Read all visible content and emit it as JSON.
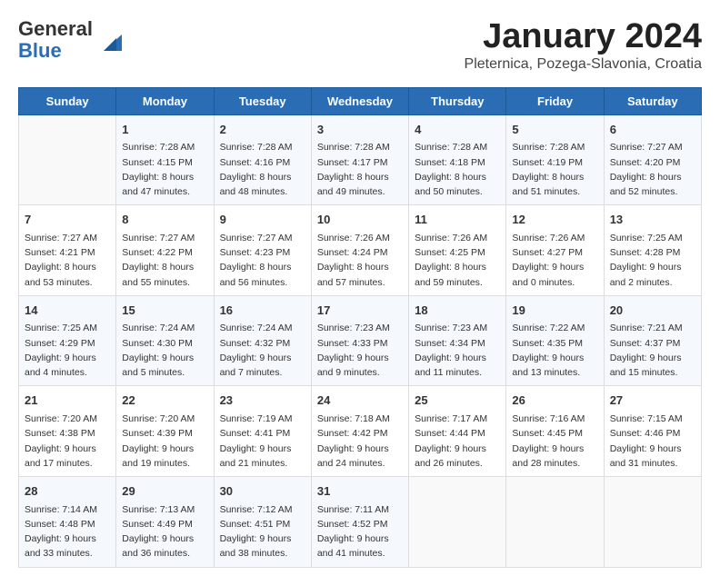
{
  "header": {
    "logo_general": "General",
    "logo_blue": "Blue",
    "month_title": "January 2024",
    "location": "Pleternica, Pozega-Slavonia, Croatia"
  },
  "weekdays": [
    "Sunday",
    "Monday",
    "Tuesday",
    "Wednesday",
    "Thursday",
    "Friday",
    "Saturday"
  ],
  "weeks": [
    [
      {
        "day": null,
        "info": null
      },
      {
        "day": "1",
        "info": "Sunrise: 7:28 AM\nSunset: 4:15 PM\nDaylight: 8 hours\nand 47 minutes."
      },
      {
        "day": "2",
        "info": "Sunrise: 7:28 AM\nSunset: 4:16 PM\nDaylight: 8 hours\nand 48 minutes."
      },
      {
        "day": "3",
        "info": "Sunrise: 7:28 AM\nSunset: 4:17 PM\nDaylight: 8 hours\nand 49 minutes."
      },
      {
        "day": "4",
        "info": "Sunrise: 7:28 AM\nSunset: 4:18 PM\nDaylight: 8 hours\nand 50 minutes."
      },
      {
        "day": "5",
        "info": "Sunrise: 7:28 AM\nSunset: 4:19 PM\nDaylight: 8 hours\nand 51 minutes."
      },
      {
        "day": "6",
        "info": "Sunrise: 7:27 AM\nSunset: 4:20 PM\nDaylight: 8 hours\nand 52 minutes."
      }
    ],
    [
      {
        "day": "7",
        "info": "Sunrise: 7:27 AM\nSunset: 4:21 PM\nDaylight: 8 hours\nand 53 minutes."
      },
      {
        "day": "8",
        "info": "Sunrise: 7:27 AM\nSunset: 4:22 PM\nDaylight: 8 hours\nand 55 minutes."
      },
      {
        "day": "9",
        "info": "Sunrise: 7:27 AM\nSunset: 4:23 PM\nDaylight: 8 hours\nand 56 minutes."
      },
      {
        "day": "10",
        "info": "Sunrise: 7:26 AM\nSunset: 4:24 PM\nDaylight: 8 hours\nand 57 minutes."
      },
      {
        "day": "11",
        "info": "Sunrise: 7:26 AM\nSunset: 4:25 PM\nDaylight: 8 hours\nand 59 minutes."
      },
      {
        "day": "12",
        "info": "Sunrise: 7:26 AM\nSunset: 4:27 PM\nDaylight: 9 hours\nand 0 minutes."
      },
      {
        "day": "13",
        "info": "Sunrise: 7:25 AM\nSunset: 4:28 PM\nDaylight: 9 hours\nand 2 minutes."
      }
    ],
    [
      {
        "day": "14",
        "info": "Sunrise: 7:25 AM\nSunset: 4:29 PM\nDaylight: 9 hours\nand 4 minutes."
      },
      {
        "day": "15",
        "info": "Sunrise: 7:24 AM\nSunset: 4:30 PM\nDaylight: 9 hours\nand 5 minutes."
      },
      {
        "day": "16",
        "info": "Sunrise: 7:24 AM\nSunset: 4:32 PM\nDaylight: 9 hours\nand 7 minutes."
      },
      {
        "day": "17",
        "info": "Sunrise: 7:23 AM\nSunset: 4:33 PM\nDaylight: 9 hours\nand 9 minutes."
      },
      {
        "day": "18",
        "info": "Sunrise: 7:23 AM\nSunset: 4:34 PM\nDaylight: 9 hours\nand 11 minutes."
      },
      {
        "day": "19",
        "info": "Sunrise: 7:22 AM\nSunset: 4:35 PM\nDaylight: 9 hours\nand 13 minutes."
      },
      {
        "day": "20",
        "info": "Sunrise: 7:21 AM\nSunset: 4:37 PM\nDaylight: 9 hours\nand 15 minutes."
      }
    ],
    [
      {
        "day": "21",
        "info": "Sunrise: 7:20 AM\nSunset: 4:38 PM\nDaylight: 9 hours\nand 17 minutes."
      },
      {
        "day": "22",
        "info": "Sunrise: 7:20 AM\nSunset: 4:39 PM\nDaylight: 9 hours\nand 19 minutes."
      },
      {
        "day": "23",
        "info": "Sunrise: 7:19 AM\nSunset: 4:41 PM\nDaylight: 9 hours\nand 21 minutes."
      },
      {
        "day": "24",
        "info": "Sunrise: 7:18 AM\nSunset: 4:42 PM\nDaylight: 9 hours\nand 24 minutes."
      },
      {
        "day": "25",
        "info": "Sunrise: 7:17 AM\nSunset: 4:44 PM\nDaylight: 9 hours\nand 26 minutes."
      },
      {
        "day": "26",
        "info": "Sunrise: 7:16 AM\nSunset: 4:45 PM\nDaylight: 9 hours\nand 28 minutes."
      },
      {
        "day": "27",
        "info": "Sunrise: 7:15 AM\nSunset: 4:46 PM\nDaylight: 9 hours\nand 31 minutes."
      }
    ],
    [
      {
        "day": "28",
        "info": "Sunrise: 7:14 AM\nSunset: 4:48 PM\nDaylight: 9 hours\nand 33 minutes."
      },
      {
        "day": "29",
        "info": "Sunrise: 7:13 AM\nSunset: 4:49 PM\nDaylight: 9 hours\nand 36 minutes."
      },
      {
        "day": "30",
        "info": "Sunrise: 7:12 AM\nSunset: 4:51 PM\nDaylight: 9 hours\nand 38 minutes."
      },
      {
        "day": "31",
        "info": "Sunrise: 7:11 AM\nSunset: 4:52 PM\nDaylight: 9 hours\nand 41 minutes."
      },
      {
        "day": null,
        "info": null
      },
      {
        "day": null,
        "info": null
      },
      {
        "day": null,
        "info": null
      }
    ]
  ]
}
